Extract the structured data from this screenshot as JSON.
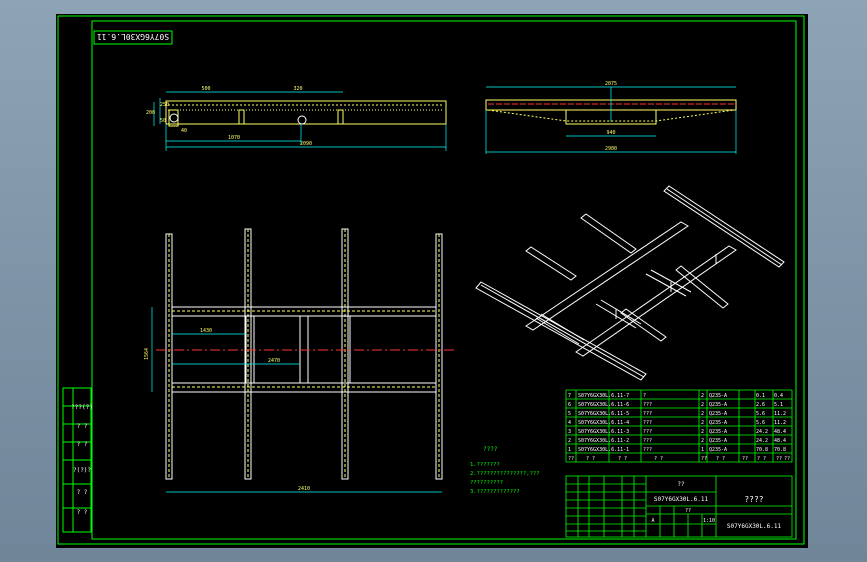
{
  "drawing_number": "S07Y6GX30L.6.11",
  "drawing_title": "????",
  "part_code": "S07Y6GX30L.6.11",
  "left_strip": {
    "cells": [
      "???(?)",
      "? ?",
      "? ?",
      "?(?)?",
      "? ?",
      "? ?",
      "? ?"
    ]
  },
  "notes": {
    "title": "????",
    "lines": [
      "1.???????",
      "2.???????????????,???",
      "  ??????????",
      "3.?????????????"
    ]
  },
  "dimensions": {
    "side_top_left": "500",
    "side_top_right": "320",
    "side_height_1": "200",
    "side_height_2": "250",
    "side_height_3": "50",
    "side_small": "40",
    "side_mid": "1070",
    "side_total": "2090",
    "front_top": "2075",
    "front_mid": "940",
    "front_total": "2900",
    "plan_height": "1564",
    "plan_left": "1430",
    "plan_mid": "2470",
    "plan_total": "2410"
  },
  "bom": {
    "header": [
      "??",
      "? ?",
      "? ?",
      "? ?",
      "??",
      "? ?",
      "??",
      "? ?",
      "??",
      "??"
    ],
    "rows": [
      [
        "7",
        "S07Y6GX30L.6.11-7",
        "?",
        "2",
        "Q235-A",
        "0.1",
        "0.4"
      ],
      [
        "6",
        "S07Y6GX30L.6.11-6",
        "???",
        "2",
        "Q235-A",
        "2.6",
        "5.1"
      ],
      [
        "5",
        "S07Y6GX30L.6.11-5",
        "???",
        "2",
        "Q235-A",
        "5.6",
        "11.2"
      ],
      [
        "4",
        "S07Y6GX30L.6.11-4",
        "???",
        "2",
        "Q235-A",
        "5.6",
        "11.2"
      ],
      [
        "3",
        "S07Y6GX30L.6.11-3",
        "???",
        "2",
        "Q235-A",
        "24.2",
        "48.4"
      ],
      [
        "2",
        "S07Y6GX30L.6.11-2",
        "???",
        "2",
        "Q235-A",
        "24.2",
        "48.4"
      ],
      [
        "1",
        "S07Y6GX30L.6.11-1",
        "???",
        "1",
        "Q235-A",
        "70.8",
        "70.8"
      ]
    ]
  },
  "title_block": {
    "group": "??",
    "scale_label": "??",
    "ratio": "1:10",
    "cells": [
      "? ?",
      "??",
      "??",
      "?????",
      "? ?",
      "? ?",
      "? ?",
      "? ?",
      "??",
      "? ?",
      "? ?",
      "A",
      "?",
      "? ?",
      "? ?"
    ]
  },
  "colors": {
    "border": "#00ff00",
    "drawing": "#ffff66",
    "dimension": "#00ffff",
    "centerline": "#ff3333",
    "geometry": "#ffffff"
  }
}
